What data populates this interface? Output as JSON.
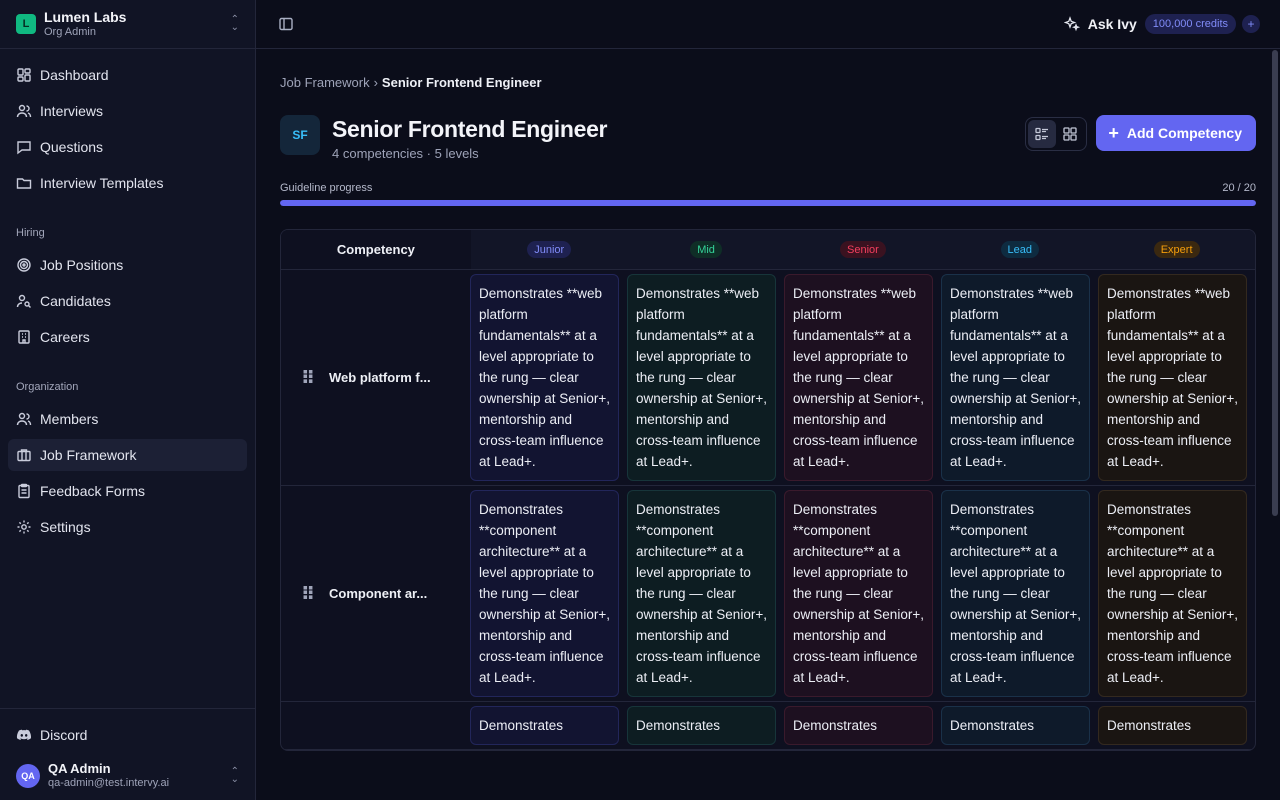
{
  "org": {
    "initial": "L",
    "name": "Lumen Labs",
    "role": "Org Admin"
  },
  "nav_main": [
    {
      "label": "Dashboard",
      "icon": "grid-icon"
    },
    {
      "label": "Interviews",
      "icon": "users-icon"
    },
    {
      "label": "Questions",
      "icon": "message-icon"
    },
    {
      "label": "Interview Templates",
      "icon": "folder-icon"
    }
  ],
  "sections": {
    "hiring": "Hiring",
    "organization": "Organization"
  },
  "nav_hiring": [
    {
      "label": "Job Positions",
      "icon": "target-icon"
    },
    {
      "label": "Candidates",
      "icon": "user-search-icon"
    },
    {
      "label": "Careers",
      "icon": "building-icon"
    }
  ],
  "nav_org": [
    {
      "label": "Members",
      "icon": "users-icon"
    },
    {
      "label": "Job Framework",
      "icon": "briefcase-icon"
    },
    {
      "label": "Feedback Forms",
      "icon": "clipboard-icon"
    },
    {
      "label": "Settings",
      "icon": "gear-icon"
    }
  ],
  "discord": "Discord",
  "user": {
    "initials": "QA",
    "name": "QA Admin",
    "email": "qa-admin@test.intervy.ai"
  },
  "topbar": {
    "ask_label": "Ask Ivy",
    "credits": "100,000 credits",
    "plus": "+"
  },
  "breadcrumb": {
    "parent": "Job Framework",
    "sep": "›",
    "current": "Senior Frontend Engineer"
  },
  "role": {
    "initials": "SF",
    "title": "Senior Frontend Engineer",
    "subtitle": "4 competencies · 5 levels"
  },
  "add_button": "Add Competency",
  "progress": {
    "label": "Guideline progress",
    "value_text": "20 / 20",
    "fraction": 1.0
  },
  "matrix": {
    "comp_header": "Competency",
    "levels": [
      {
        "label": "Junior",
        "color": "#818cf8",
        "bg": "#1e2150"
      },
      {
        "label": "Mid",
        "color": "#34d399",
        "bg": "#0f2e27"
      },
      {
        "label": "Senior",
        "color": "#f43f5e",
        "bg": "#3a1220"
      },
      {
        "label": "Lead",
        "color": "#38bdf8",
        "bg": "#0e2b40"
      },
      {
        "label": "Expert",
        "color": "#f59e0b",
        "bg": "#3a2810"
      }
    ],
    "rows": [
      {
        "name": "Web platform f...",
        "cells": [
          "Demonstrates **web platform fundamentals** at a level appropriate to the rung — clear ownership at Senior+, mentorship and cross-team influence at Lead+.",
          "Demonstrates **web platform fundamentals** at a level appropriate to the rung — clear ownership at Senior+, mentorship and cross-team influence at Lead+.",
          "Demonstrates **web platform fundamentals** at a level appropriate to the rung — clear ownership at Senior+, mentorship and cross-team influence at Lead+.",
          "Demonstrates **web platform fundamentals** at a level appropriate to the rung — clear ownership at Senior+, mentorship and cross-team influence at Lead+.",
          "Demonstrates **web platform fundamentals** at a level appropriate to the rung — clear ownership at Senior+, mentorship and cross-team influence at Lead+."
        ]
      },
      {
        "name": "Component ar...",
        "cells": [
          "Demonstrates **component architecture** at a level appropriate to the rung — clear ownership at Senior+, mentorship and cross-team influence at Lead+.",
          "Demonstrates **component architecture** at a level appropriate to the rung — clear ownership at Senior+, mentorship and cross-team influence at Lead+.",
          "Demonstrates **component architecture** at a level appropriate to the rung — clear ownership at Senior+, mentorship and cross-team influence at Lead+.",
          "Demonstrates **component architecture** at a level appropriate to the rung — clear ownership at Senior+, mentorship and cross-team influence at Lead+.",
          "Demonstrates **component architecture** at a level appropriate to the rung — clear ownership at Senior+, mentorship and cross-team influence at Lead+."
        ]
      },
      {
        "name": "",
        "cells": [
          "Demonstrates",
          "Demonstrates",
          "Demonstrates",
          "Demonstrates",
          "Demonstrates"
        ]
      }
    ]
  }
}
